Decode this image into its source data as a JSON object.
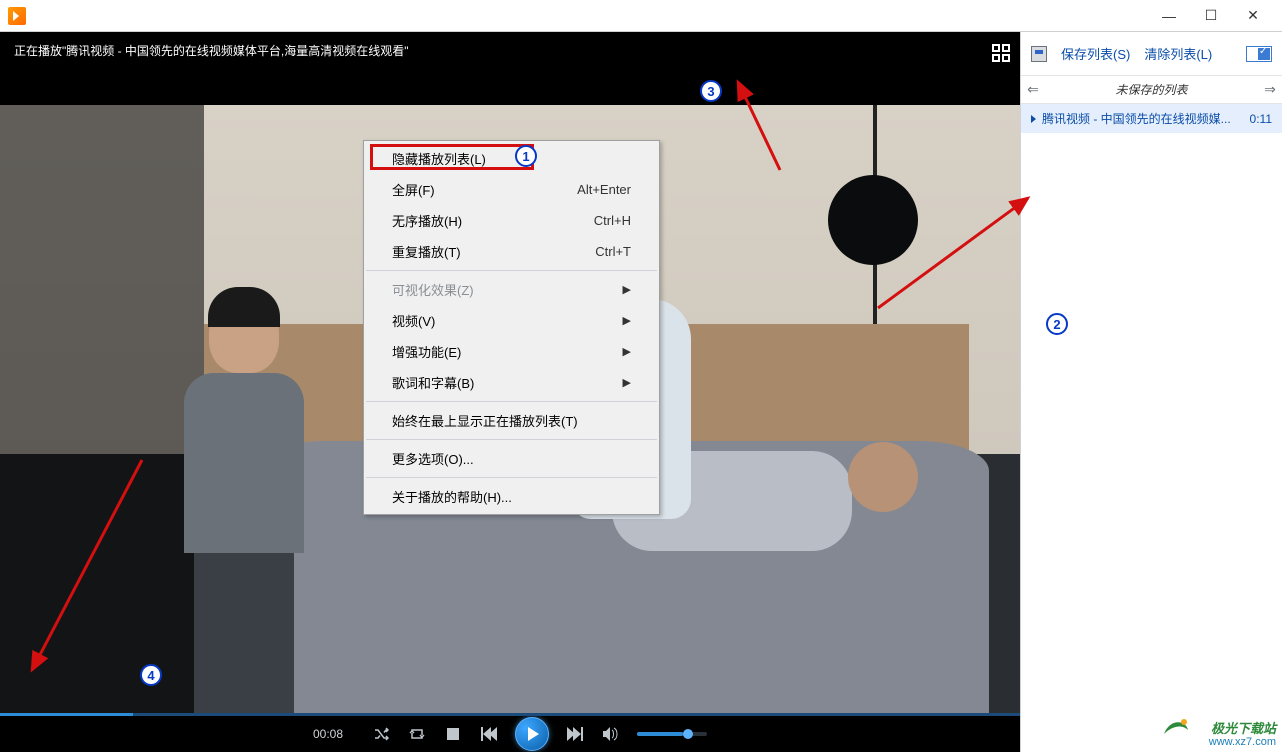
{
  "titlebar": {
    "title": ""
  },
  "window_controls": {
    "minimize": "—",
    "maximize": "☐",
    "close": "✕"
  },
  "video": {
    "title": "正在播放\"腾讯视频 - 中国领先的在线视频媒体平台,海量高清视频在线观看\"",
    "current_time": "00:08",
    "progress_percent": 13
  },
  "context_menu": {
    "items": [
      {
        "label": "隐藏播放列表(L)",
        "shortcut": "",
        "hasSub": false,
        "disabled": false
      },
      {
        "label": "全屏(F)",
        "shortcut": "Alt+Enter",
        "hasSub": false,
        "disabled": false
      },
      {
        "label": "无序播放(H)",
        "shortcut": "Ctrl+H",
        "hasSub": false,
        "disabled": false
      },
      {
        "label": "重复播放(T)",
        "shortcut": "Ctrl+T",
        "hasSub": false,
        "disabled": false
      },
      {
        "sep": true
      },
      {
        "label": "可视化效果(Z)",
        "shortcut": "",
        "hasSub": true,
        "disabled": true
      },
      {
        "label": "视频(V)",
        "shortcut": "",
        "hasSub": true,
        "disabled": false
      },
      {
        "label": "增强功能(E)",
        "shortcut": "",
        "hasSub": true,
        "disabled": false
      },
      {
        "label": "歌词和字幕(B)",
        "shortcut": "",
        "hasSub": true,
        "disabled": false
      },
      {
        "sep": true
      },
      {
        "label": "始终在最上显示正在播放列表(T)",
        "shortcut": "",
        "hasSub": false,
        "disabled": false
      },
      {
        "sep": true
      },
      {
        "label": "更多选项(O)...",
        "shortcut": "",
        "hasSub": false,
        "disabled": false
      },
      {
        "sep": true
      },
      {
        "label": "关于播放的帮助(H)...",
        "shortcut": "",
        "hasSub": false,
        "disabled": false
      }
    ]
  },
  "sidebar": {
    "save_list": "保存列表(S)",
    "clear_list": "清除列表(L)",
    "title": "未保存的列表",
    "item": {
      "name": "腾讯视频 - 中国领先的在线视频媒...",
      "duration": "0:11"
    }
  },
  "annotations": {
    "n1": "1",
    "n2": "2",
    "n3": "3",
    "n4": "4"
  },
  "watermark": {
    "brand": "极光下载站",
    "url": "www.xz7.com"
  }
}
